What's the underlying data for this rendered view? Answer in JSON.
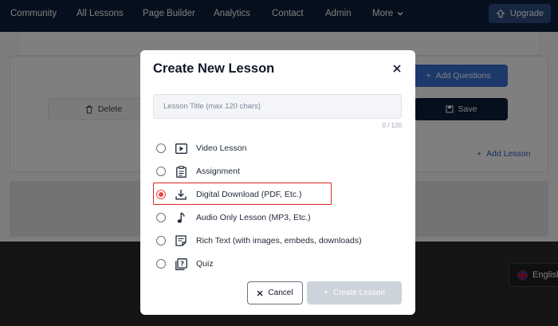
{
  "nav": {
    "items": [
      "Community",
      "All Lessons",
      "Page Builder",
      "Analytics",
      "Contact",
      "Admin",
      "More"
    ],
    "upgrade_label": "Upgrade"
  },
  "background": {
    "add_questions_label": "Add Questions",
    "delete_label": "Delete",
    "save_label": "Save",
    "add_lesson_label": "Add Lesson",
    "language_label": "English"
  },
  "modal": {
    "title": "Create New Lesson",
    "title_input": {
      "placeholder": "Lesson Title (max 120 chars)",
      "value": ""
    },
    "char_count": "0 / 120",
    "options": [
      {
        "label": "Video Lesson",
        "icon": "video-icon",
        "selected": false
      },
      {
        "label": "Assignment",
        "icon": "clipboard-icon",
        "selected": false
      },
      {
        "label": "Digital Download (PDF, Etc.)",
        "icon": "download-icon",
        "selected": true
      },
      {
        "label": "Audio Only Lesson (MP3, Etc.)",
        "icon": "music-note-icon",
        "selected": false
      },
      {
        "label": "Rich Text (with images, embeds, downloads)",
        "icon": "rich-text-icon",
        "selected": false
      },
      {
        "label": "Quiz",
        "icon": "quiz-icon",
        "selected": false
      }
    ],
    "cancel_label": "Cancel",
    "create_label": "Create Lesson"
  },
  "colors": {
    "nav_bg": "#0d1e3a",
    "primary_blue": "#3b73d6",
    "highlight_red": "#e02424",
    "radio_selected": "#ef4444",
    "create_disabled": "#cdd3da"
  }
}
